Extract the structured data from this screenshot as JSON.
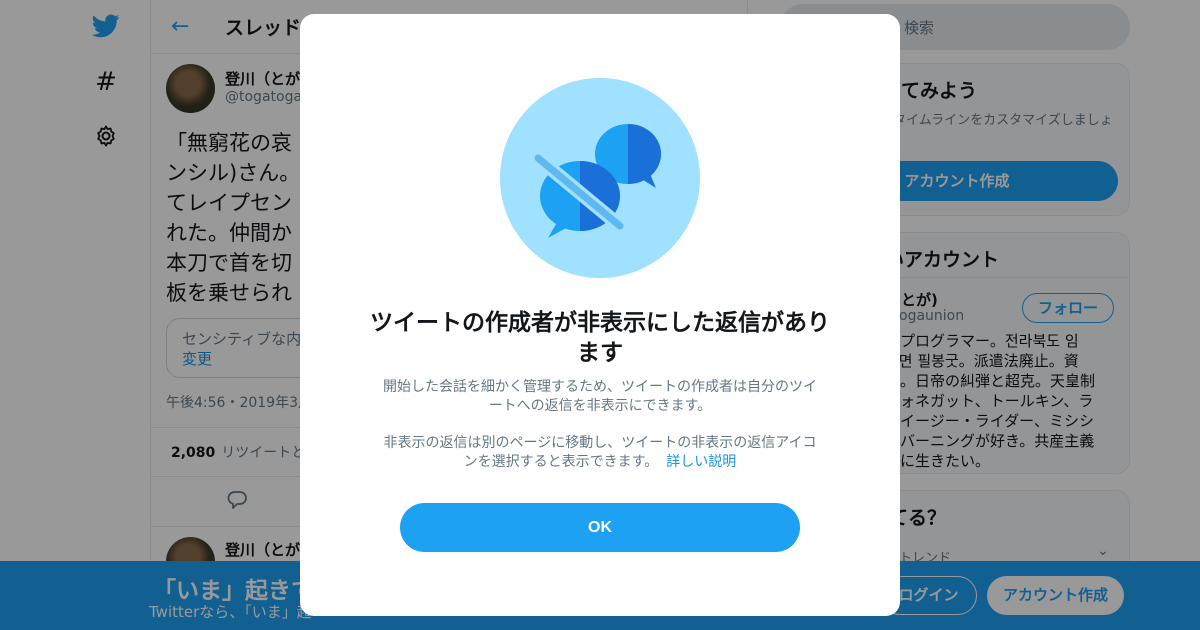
{
  "colors": {
    "accent": "#1da1f2",
    "link": "#1b95e0",
    "overlay": "rgba(0,0,0,0.4)"
  },
  "nav": {
    "logo_icon": "twitter-bird-icon",
    "hash_icon": "hashtag-icon",
    "hash_glyph": "#",
    "settings_icon": "gear-icon"
  },
  "main": {
    "back_icon": "arrow-left-icon",
    "back_glyph": "←",
    "title": "スレッド",
    "tweet": {
      "name": "登川（とが",
      "handle": "@togatogau",
      "body": "「無窮花の哀\nンシル)さん。\nてレイプセン\nれた。仲間か\n本刀で首を切\n板を乗せられ",
      "sensitive_text": "センシティブな内",
      "sensitive_change": "変更",
      "timestamp": "午後4:56・2019年3月",
      "retweet_count": "2,080",
      "retweet_label": "リツイートと",
      "reply_icon": "reply-icon"
    },
    "reply": {
      "name": "登川（とが"
    }
  },
  "right": {
    "search_placeholder": "検索",
    "signup_card": {
      "title": "ってみよう",
      "subtitle": "タイムラインをカスタマイズしましょ",
      "button": "アカウント作成"
    },
    "suggest_card": {
      "title": "いアカウント",
      "user_name": "とが)",
      "user_handle": "ogaunion",
      "follow": "フォロー",
      "bio": "。プログラマー。전라북도 임\n실면 필봉굿。派遣法廃止。資\n棄。日帝の糾弾と超克。天皇制\nヴォネガット、トールキン、ラ\n、イージー・ライダー、ミシシ\n・バーニングが好き。共産主義\n由に生きたい。"
    },
    "trends_card": {
      "title": "てる？",
      "subtitle": "トレンド",
      "chevron_icon": "chevron-down-icon",
      "chevron_glyph": "⌄"
    }
  },
  "bottom_bar": {
    "headline": "「いま」起きて",
    "subline": "Twitterなら、「いま」起",
    "login": "ログイン",
    "signup": "アカウント作成"
  },
  "modal": {
    "illustration_icon": "hidden-replies-icon",
    "title": "ツイートの作成者が非表示にした返信があります",
    "desc1": "開始した会話を細かく管理するため、ツイートの作成者は自分のツイートへの返信を非表示にできます。",
    "desc2": "非表示の返信は別のページに移動し、ツイートの非表示の返信アイコンを選択すると表示できます。",
    "learn_more": "詳しい説明",
    "ok": "OK"
  }
}
